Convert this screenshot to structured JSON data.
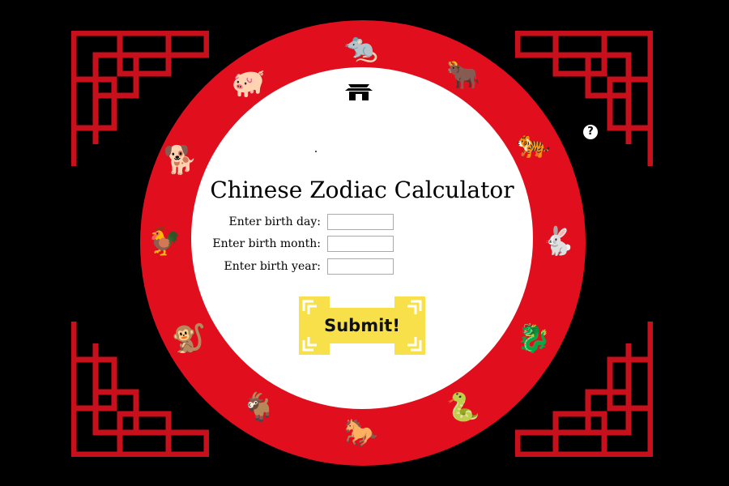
{
  "app": {
    "title": "Chinese Zodiac Calculator"
  },
  "colors": {
    "background": "#000000",
    "wheel_red": "#e10f1d",
    "lattice_red": "#c8101c",
    "button_yellow": "#f7e04a"
  },
  "icons": {
    "header": "temple-icon",
    "help": "question-mark-icon",
    "help_glyph": "?"
  },
  "form": {
    "day_label": "Enter birth day:",
    "month_label": "Enter birth month:",
    "year_label": "Enter birth year:",
    "day_value": "",
    "month_value": "",
    "year_value": "",
    "submit_label": "Submit!"
  },
  "zodiac": [
    {
      "name": "rat",
      "glyph": "🐀"
    },
    {
      "name": "ox",
      "glyph": "🐂"
    },
    {
      "name": "tiger",
      "glyph": "🐅"
    },
    {
      "name": "rabbit",
      "glyph": "🐇"
    },
    {
      "name": "dragon",
      "glyph": "🐉"
    },
    {
      "name": "snake",
      "glyph": "🐍"
    },
    {
      "name": "horse",
      "glyph": "🐎"
    },
    {
      "name": "goat",
      "glyph": "🐐"
    },
    {
      "name": "monkey",
      "glyph": "🐒"
    },
    {
      "name": "rooster",
      "glyph": "🐓"
    },
    {
      "name": "dog",
      "glyph": "🐕"
    },
    {
      "name": "pig",
      "glyph": "🐖"
    }
  ]
}
